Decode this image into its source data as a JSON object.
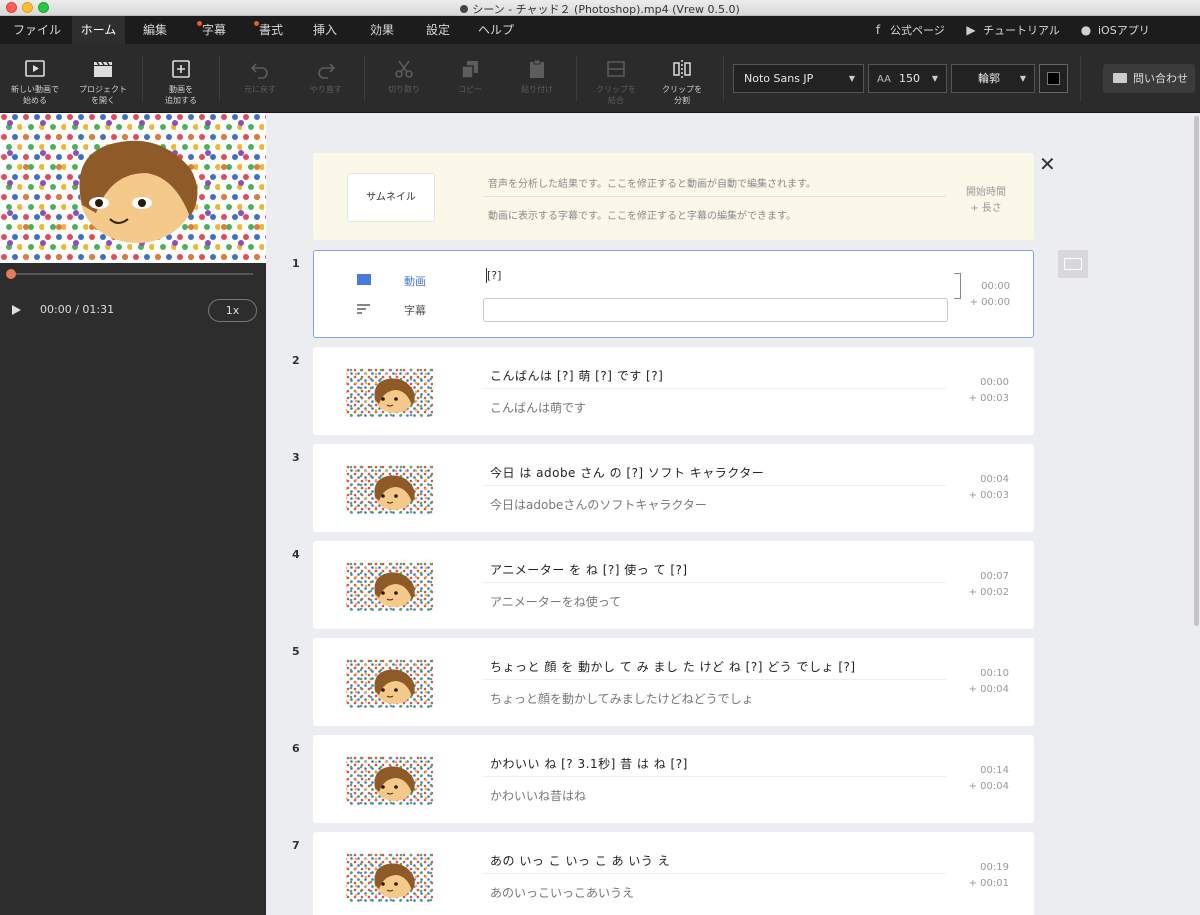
{
  "window": {
    "title": "シーン - チャッド２ (Photoshop).mp4 (Vrew 0.5.0)"
  },
  "menu": {
    "items": [
      {
        "label": "ファイル"
      },
      {
        "label": "ホーム"
      },
      {
        "label": "編集"
      },
      {
        "label": "字幕"
      },
      {
        "label": "書式"
      },
      {
        "label": "挿入"
      },
      {
        "label": "効果"
      },
      {
        "label": "設定"
      },
      {
        "label": "ヘルプ"
      }
    ],
    "active": "ホーム",
    "right": [
      {
        "label": "公式ページ",
        "icon": "facebook-icon"
      },
      {
        "label": "チュートリアル",
        "icon": "youtube-icon"
      },
      {
        "label": "iOSアプリ",
        "icon": "apple-icon"
      }
    ]
  },
  "toolbar": {
    "buttons": [
      {
        "label": "新しい動画で\n始める",
        "icon": "play-square-icon",
        "enabled": true
      },
      {
        "label": "プロジェクト\nを開く",
        "icon": "clapperboard-icon",
        "enabled": true
      },
      {
        "label": "動画を\n追加する",
        "icon": "add-square-icon",
        "enabled": true
      },
      {
        "label": "元に戻す",
        "icon": "undo-icon",
        "enabled": false
      },
      {
        "label": "やり直す",
        "icon": "redo-icon",
        "enabled": false
      },
      {
        "label": "切り取り",
        "icon": "scissors-icon",
        "enabled": false
      },
      {
        "label": "コピー",
        "icon": "copy-icon",
        "enabled": false
      },
      {
        "label": "貼り付け",
        "icon": "paste-icon",
        "enabled": false
      },
      {
        "label": "クリップを\n結合",
        "icon": "merge-icon",
        "enabled": false
      },
      {
        "label": "クリップを\n分割",
        "icon": "split-icon",
        "enabled": true
      }
    ],
    "font": "Noto Sans JP",
    "font_size": "150",
    "outline": "輪郭",
    "text_color": "#000000",
    "contact": "問い合わせ"
  },
  "player": {
    "time": "00:00 / 01:31",
    "speed": "1x",
    "progress": 0
  },
  "header": {
    "thumbnail_button": "サムネイル",
    "line1": "音声を分析した結果です。ここを修正すると動画が自動で編集されます。",
    "line2": "動画に表示する字幕です。ここを修正すると字幕の編集ができます。",
    "start_label": "開始時間",
    "length_label": "+ 長さ"
  },
  "first_clip": {
    "number": "1",
    "video_label": "動画",
    "subtitle_label": "字幕",
    "video_text": "[?]",
    "start": "00:00",
    "length": "+ 00:00"
  },
  "clips": [
    {
      "number": "2",
      "recognized": "こんばんは [?] 萌 [?] です [?]",
      "subtitle": "こんばんは萌です",
      "start": "00:00",
      "length": "+ 00:03"
    },
    {
      "number": "3",
      "recognized": "今日 は adobe さん の [?] ソフト キャラクター",
      "subtitle": "今日はadobeさんのソフトキャラクター",
      "start": "00:04",
      "length": "+ 00:03"
    },
    {
      "number": "4",
      "recognized": "アニメーター を ね [?] 使っ て [?]",
      "subtitle": "アニメーターをね使って",
      "start": "00:07",
      "length": "+ 00:02"
    },
    {
      "number": "5",
      "recognized": "ちょっと 顔 を 動かし て み まし た けど ね [?] どう でしょ [?]",
      "subtitle": "ちょっと顔を動かしてみましたけどねどうでしょ",
      "start": "00:10",
      "length": "+ 00:04"
    },
    {
      "number": "6",
      "recognized": "かわいい ね [? 3.1秒] 昔 は ね [?]",
      "subtitle": "かわいいね昔はね",
      "start": "00:14",
      "length": "+ 00:04"
    },
    {
      "number": "7",
      "recognized": "あの いっ こ いっ こ あ いう え",
      "subtitle": "あのいっこいっこあいうえ",
      "start": "00:19",
      "length": "+ 00:01"
    }
  ]
}
